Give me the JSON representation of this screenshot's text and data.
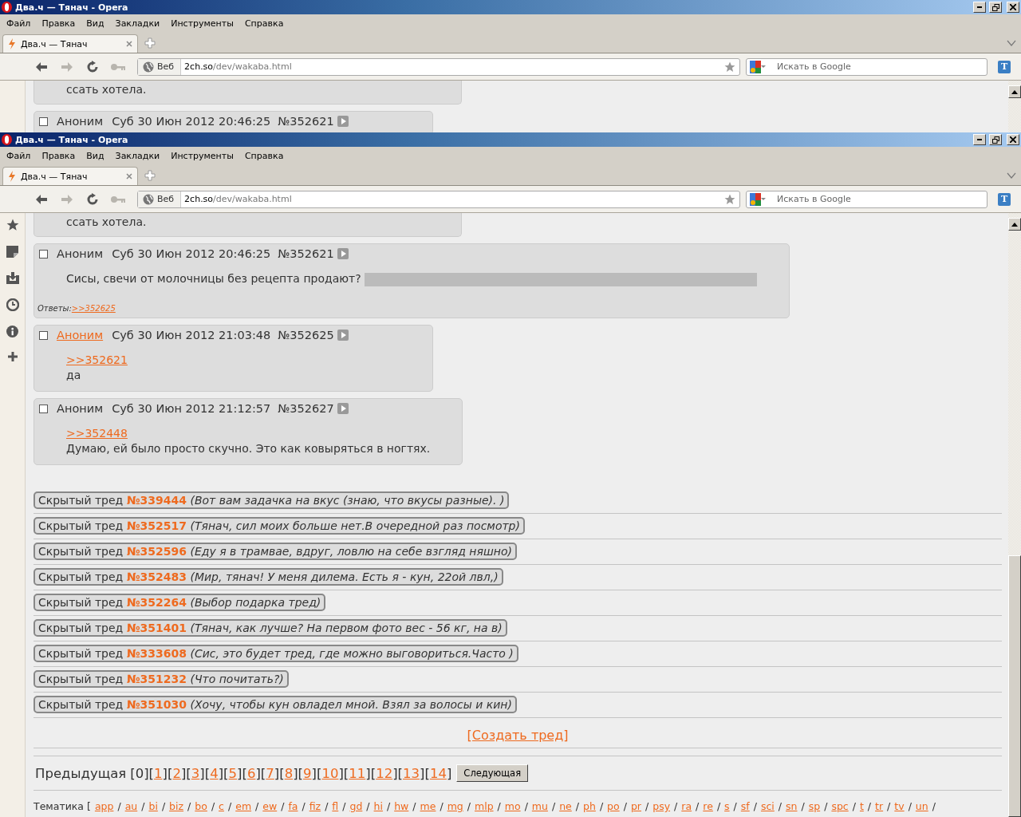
{
  "windows": [
    {
      "title": "Два.ч — Тянач - Opera",
      "menu": [
        "Файл",
        "Правка",
        "Вид",
        "Закладки",
        "Инструменты",
        "Справка"
      ],
      "tabs": [
        {
          "label": "Два.ч — Тянач",
          "selected": true
        }
      ],
      "toolbar_buttons": [
        {
          "kind": "back",
          "disabled": false
        },
        {
          "kind": "forward",
          "disabled": true
        },
        {
          "kind": "reload",
          "disabled": false
        },
        {
          "kind": "key",
          "disabled": true
        }
      ],
      "address": {
        "badge": "Веб",
        "host": "2ch.so",
        "path": "/dev/wakaba.html"
      },
      "search": {
        "placeholder": "Искать в Google"
      },
      "extension_label": "T",
      "posts": [
        {
          "kind": "tail",
          "body": [
            [
              {
                "kind": "text",
                "text": "ссать хотела."
              }
            ]
          ]
        },
        {
          "kind": "post",
          "checked": false,
          "name": "Аноним",
          "name_link": false,
          "date": "Суб 30 Июн 2012 20:46:25",
          "number": "№352621"
        }
      ]
    },
    {
      "title": "Два.ч — Тянач - Opera",
      "menu": [
        "Файл",
        "Правка",
        "Вид",
        "Закладки",
        "Инструменты",
        "Справка"
      ],
      "tabs": [
        {
          "label": "Два.ч — Тянач",
          "selected": true
        }
      ],
      "toolbar_buttons": [
        {
          "kind": "back",
          "disabled": false
        },
        {
          "kind": "forward",
          "disabled": true
        },
        {
          "kind": "reload",
          "disabled": false
        },
        {
          "kind": "key",
          "disabled": true
        }
      ],
      "address": {
        "badge": "Веб",
        "host": "2ch.so",
        "path": "/dev/wakaba.html"
      },
      "search": {
        "placeholder": "Искать в Google"
      },
      "extension_label": "T",
      "posts": [
        {
          "kind": "tail",
          "body": [
            [
              {
                "kind": "text",
                "text": "ссать хотела."
              }
            ]
          ]
        },
        {
          "kind": "post",
          "checked": false,
          "name": "Аноним",
          "name_link": false,
          "date": "Суб 30 Июн 2012 20:46:25",
          "number": "№352621",
          "body": [
            [
              {
                "kind": "text",
                "text": "Сисы, свечи от молочницы без рецепта продают?"
              },
              {
                "kind": "spoiler"
              }
            ]
          ],
          "replies": {
            "label": "Ответы:",
            "links": [
              ">>352625"
            ]
          }
        },
        {
          "kind": "post",
          "checked": false,
          "name": "Аноним",
          "name_link": true,
          "date": "Суб 30 Июн 2012 21:03:48",
          "number": "№352625",
          "body": [
            [
              {
                "kind": "link",
                "text": ">>352621"
              }
            ],
            [
              {
                "kind": "text",
                "text": "да"
              }
            ]
          ]
        },
        {
          "kind": "post",
          "checked": false,
          "name": "Аноним",
          "name_link": false,
          "date": "Суб 30 Июн 2012 21:12:57",
          "number": "№352627",
          "body": [
            [
              {
                "kind": "link",
                "text": ">>352448"
              }
            ],
            [
              {
                "kind": "text",
                "text": "Думаю, ей было просто скучно. Это как ковыряться в ногтях."
              }
            ]
          ]
        }
      ],
      "hidden_threads": [
        {
          "label": "Скрытый тред",
          "number": "№339444",
          "subject": "(Вот вам задачка на вкус (знаю, что вкусы разные). )"
        },
        {
          "label": "Скрытый тред",
          "number": "№352517",
          "subject": "(Тянач, сил моих больше нет.В очередной раз посмотр)"
        },
        {
          "label": "Скрытый тред",
          "number": "№352596",
          "subject": "(Еду я в трамвае, вдруг, ловлю на себе взгляд няшно)"
        },
        {
          "label": "Скрытый тред",
          "number": "№352483",
          "subject": "(Мир, тянач! У меня дилема. Есть я - кун, 22ой лвл,)"
        },
        {
          "label": "Скрытый тред",
          "number": "№352264",
          "subject": "(Выбор подарка тред)"
        },
        {
          "label": "Скрытый тред",
          "number": "№351401",
          "subject": "(Тянач, как лучше? На первом фото вес - 56 кг, на в)"
        },
        {
          "label": "Скрытый тред",
          "number": "№333608",
          "subject": "(Сис, это будет тред, где можно выговориться.Часто )"
        },
        {
          "label": "Скрытый тред",
          "number": "№351232",
          "subject": "(Что почитать?)"
        },
        {
          "label": "Скрытый тред",
          "number": "№351030",
          "subject": "(Хочу, чтобы кун овладел мной. Взял за волосы и кин)"
        }
      ],
      "create_thread": "[Создать тред]",
      "pagination": {
        "previous": "Предыдущая",
        "open": "[",
        "close": "]",
        "next": "Следующая",
        "pages": [
          {
            "label": "0",
            "selected": true
          },
          {
            "label": "1",
            "selected": false
          },
          {
            "label": "2",
            "selected": false
          },
          {
            "label": "3",
            "selected": false
          },
          {
            "label": "4",
            "selected": false
          },
          {
            "label": "5",
            "selected": false
          },
          {
            "label": "6",
            "selected": false
          },
          {
            "label": "7",
            "selected": false
          },
          {
            "label": "8",
            "selected": false
          },
          {
            "label": "9",
            "selected": false
          },
          {
            "label": "10",
            "selected": false
          },
          {
            "label": "11",
            "selected": false
          },
          {
            "label": "12",
            "selected": false
          },
          {
            "label": "13",
            "selected": false
          },
          {
            "label": "14",
            "selected": false
          }
        ]
      },
      "boards": {
        "label": "Тематика [",
        "separator": "/",
        "items": [
          "app",
          "au",
          "bi",
          "biz",
          "bo",
          "c",
          "em",
          "ew",
          "fa",
          "fiz",
          "fl",
          "gd",
          "hi",
          "hw",
          "me",
          "mg",
          "mlp",
          "mo",
          "mu",
          "ne",
          "ph",
          "po",
          "pr",
          "psy",
          "ra",
          "re",
          "s",
          "sf",
          "sci",
          "sn",
          "sp",
          "spc",
          "t",
          "tr",
          "tv",
          "un"
        ]
      }
    }
  ]
}
